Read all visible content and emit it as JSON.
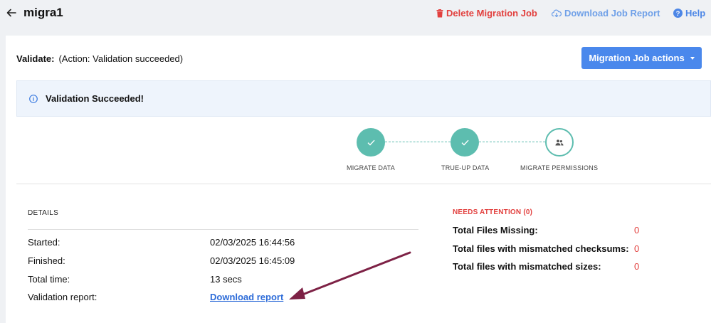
{
  "header": {
    "title": "migra1",
    "delete_label": "Delete Migration Job",
    "report_label": "Download Job Report",
    "help_label": "Help"
  },
  "validate": {
    "label": "Validate:",
    "status": "(Action: Validation succeeded)"
  },
  "actions_button": "Migration Job actions",
  "alert": {
    "text": "Validation Succeeded!"
  },
  "steps": [
    {
      "label": "MIGRATE DATA",
      "state": "done"
    },
    {
      "label": "TRUE-UP DATA",
      "state": "done"
    },
    {
      "label": "MIGRATE PERMISSIONS",
      "state": "pending"
    }
  ],
  "details": {
    "heading": "DETAILS",
    "rows": [
      {
        "label": "Started:",
        "value": "02/03/2025 16:44:56"
      },
      {
        "label": "Finished:",
        "value": "02/03/2025 16:45:09"
      },
      {
        "label": "Total time:",
        "value": "13 secs"
      },
      {
        "label": "Validation report:",
        "value": "Download report"
      }
    ]
  },
  "needs_attention": {
    "heading": "NEEDS ATTENTION (0)",
    "rows": [
      {
        "label": "Total Files Missing:",
        "value": "0"
      },
      {
        "label": "Total files with mismatched checksums:",
        "value": "0"
      },
      {
        "label": "Total files with mismatched sizes:",
        "value": "0"
      }
    ]
  },
  "colors": {
    "accent": "#4a88ec",
    "danger": "#e2403e",
    "success": "#5dbdaf",
    "annotation_arrow": "#7d2145"
  }
}
